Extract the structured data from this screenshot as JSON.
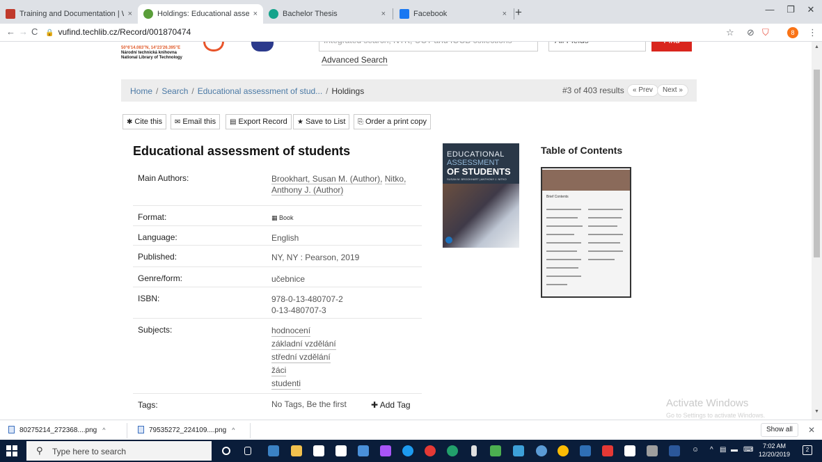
{
  "browser": {
    "tabs": [
      {
        "title": "Training and Documentation | W",
        "favicon_color": "#c0392b",
        "close": "×"
      },
      {
        "title": "Holdings: Educational assessmen",
        "favicon_color": "#5a9e3a",
        "close": "×"
      },
      {
        "title": "Bachelor Thesis",
        "favicon_color": "#14a38b",
        "close": "×"
      },
      {
        "title": "Facebook",
        "favicon_color": "#1877f2",
        "close": "×"
      }
    ],
    "new_tab": "+",
    "window_controls": [
      "—",
      "❐",
      "✕"
    ],
    "nav": {
      "back": "←",
      "forward": "→",
      "reload": "C"
    },
    "url": "vufind.techlib.cz/Record/001870474",
    "lock": "🔒",
    "toolbar_icons": {
      "star": "☆",
      "block": "⊘",
      "shield": "⛉",
      "menu": "⋮"
    },
    "profile_initial": "8"
  },
  "site": {
    "logo_coords": "50°6'14.083\"N, 14°23'26.395\"E",
    "logo_name_cz": "Národní technická knihovna",
    "logo_name_en": "National Library of Technology",
    "search_placeholder": "Integrated search, NTK, UCT and IOCB collections",
    "search_field": "All Fields",
    "find_button": "Find",
    "advanced_search": "Advanced Search"
  },
  "breadcrumb": {
    "home": "Home",
    "search": "Search",
    "record": "Educational assessment of stud...",
    "current": "Holdings",
    "separator": "/"
  },
  "pager": {
    "result_count": "#3 of 403 results",
    "prev": "« Prev",
    "next": "Next »"
  },
  "actions": [
    {
      "icon": "✱",
      "label": "Cite this"
    },
    {
      "icon": "✉",
      "label": "Email this"
    },
    {
      "icon": "▤",
      "label": "Export Record"
    },
    {
      "icon": "★",
      "label": "Save to List"
    },
    {
      "icon": "⎘",
      "label": "Order a print copy"
    }
  ],
  "record": {
    "title": "Educational assessment of students",
    "details": [
      {
        "label": "Main Authors:",
        "value": ""
      },
      {
        "label": "Format:",
        "value": "Book"
      },
      {
        "label": "Language:",
        "value": "English"
      },
      {
        "label": "Published:",
        "value": "NY, NY : Pearson, 2019"
      },
      {
        "label": "Genre/form:",
        "value": "učebnice"
      },
      {
        "label": "ISBN:",
        "value": ""
      },
      {
        "label": "Subjects:",
        "value": ""
      },
      {
        "label": "Tags:",
        "value": "No Tags, Be the first"
      }
    ],
    "authors_line1": "Brookhart, Susan M. (Author),",
    "authors_line1_link2": "Nitko,",
    "authors_line2": "Anthony J. (Author)",
    "format_icon": "book-icon",
    "isbn": [
      "978-0-13-480707-2",
      "0-13-480707-3"
    ],
    "subjects": [
      "hodnocení",
      "základní vzdělání",
      "střední vzdělání",
      "žáci",
      "studenti"
    ],
    "add_tag": "Add Tag"
  },
  "cover": {
    "line1": "EDUCATIONAL",
    "line2": "ASSESSMENT",
    "line3": "OF STUDENTS",
    "authors": "SUSAN M. BROOKHART | ANTHONY J. NITKO"
  },
  "toc": {
    "title": "Table of Contents",
    "thumb_heading": "Brief Contents"
  },
  "watermark": {
    "line1": "Activate Windows",
    "line2": "Go to Settings to activate Windows."
  },
  "downloads": {
    "items": [
      "80275214_272368....png",
      "79535272_224109....png"
    ],
    "caret": "^",
    "show_all": "Show all",
    "close": "✕"
  },
  "taskbar": {
    "search_placeholder": "Type here to search",
    "time": "7:02 AM",
    "date": "12/20/2019",
    "notif": "2"
  }
}
